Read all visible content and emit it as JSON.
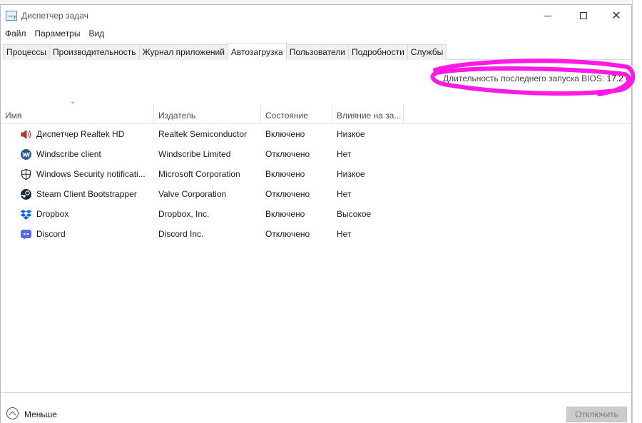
{
  "window": {
    "title": "Диспетчер задач",
    "min_icon": "minimize-icon",
    "max_icon": "maximize-icon",
    "close_icon": "close-icon",
    "close_glyph": "✕"
  },
  "menu": [
    "Файл",
    "Параметры",
    "Вид"
  ],
  "tabs": [
    {
      "label": "Процессы",
      "active": false
    },
    {
      "label": "Производительность",
      "active": false
    },
    {
      "label": "Журнал приложений",
      "active": false
    },
    {
      "label": "Автозагрузка",
      "active": true
    },
    {
      "label": "Пользователи",
      "active": false
    },
    {
      "label": "Подробности",
      "active": false
    },
    {
      "label": "Службы",
      "active": false
    }
  ],
  "bios": {
    "label": "Длительность последнего запуска BIOS:",
    "value": "17.2 с"
  },
  "sort_glyph": "⌄",
  "columns": {
    "name": "Имя",
    "publisher": "Издатель",
    "state": "Состояние",
    "impact": "Влияние на за..."
  },
  "rows": [
    {
      "icon": "speaker-icon",
      "name": "Диспетчер Realtek HD",
      "publisher": "Realtek Semiconductor",
      "state": "Включено",
      "impact": "Низкое"
    },
    {
      "icon": "windscribe-icon",
      "name": "Windscribe client",
      "publisher": "Windscribe Limited",
      "state": "Отключено",
      "impact": "Нет"
    },
    {
      "icon": "shield-icon",
      "name": "Windows Security notificati...",
      "publisher": "Microsoft Corporation",
      "state": "Включено",
      "impact": "Низкое"
    },
    {
      "icon": "steam-icon",
      "name": "Steam Client Bootstrapper",
      "publisher": "Valve Corporation",
      "state": "Отключено",
      "impact": "Нет"
    },
    {
      "icon": "dropbox-icon",
      "name": "Dropbox",
      "publisher": "Dropbox, Inc.",
      "state": "Включено",
      "impact": "Высокое"
    },
    {
      "icon": "discord-icon",
      "name": "Discord",
      "publisher": "Discord Inc.",
      "state": "Отключено",
      "impact": "Нет"
    }
  ],
  "footer": {
    "less_label": "Меньше",
    "disable_label": "Отключить"
  },
  "colors": {
    "highlight": "#ff19e6",
    "disabled_button": "#cccccc"
  }
}
